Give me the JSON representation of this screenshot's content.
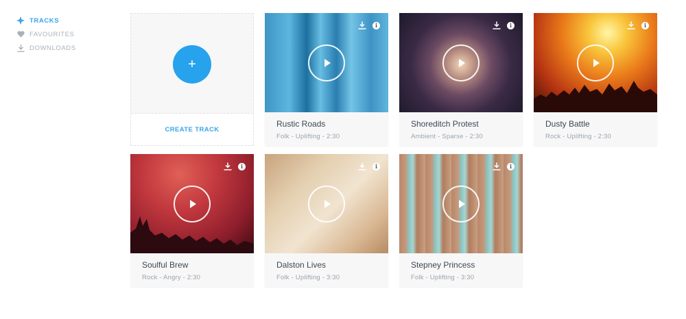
{
  "sidebar": {
    "items": [
      {
        "label": "TRACKS",
        "icon": "tracks-icon",
        "active": true
      },
      {
        "label": "FAVOURITES",
        "icon": "heart-icon",
        "active": false
      },
      {
        "label": "DOWNLOADS",
        "icon": "download-icon",
        "active": false
      }
    ]
  },
  "create": {
    "label": "CREATE TRACK",
    "plus": "+"
  },
  "tracks": [
    {
      "title": "Rustic Roads",
      "meta": "Folk - Uplifting - 2:30"
    },
    {
      "title": "Shoreditch Protest",
      "meta": "Ambient - Sparse - 2:30"
    },
    {
      "title": "Dusty Battle",
      "meta": "Rock - Uplifting - 2:30"
    },
    {
      "title": "Soulful Brew",
      "meta": "Rock - Angry - 2:30"
    },
    {
      "title": "Dalston Lives",
      "meta": "Folk - Uplifting - 3:30"
    },
    {
      "title": "Stepney Princess",
      "meta": "Folk - Uplifting - 3:30"
    }
  ],
  "colors": {
    "accent": "#27a2ec",
    "nav_active": "#3aa5e8",
    "nav_inactive": "#a9b1b9"
  }
}
